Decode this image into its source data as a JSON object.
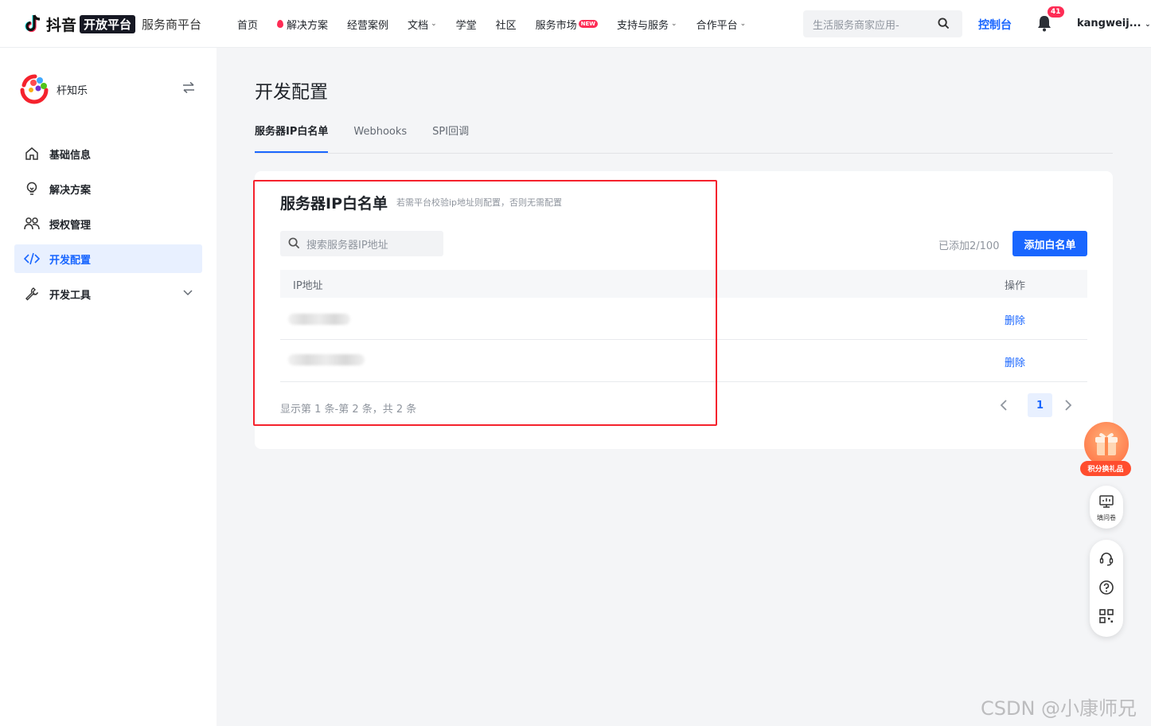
{
  "header": {
    "logo_word": "抖音",
    "logo_badge": "开放平台",
    "logo_sub": "服务商平台",
    "nav": [
      {
        "label": "首页"
      },
      {
        "label": "解决方案"
      },
      {
        "label": "经营案例"
      },
      {
        "label": "文档"
      },
      {
        "label": "学堂"
      },
      {
        "label": "社区"
      },
      {
        "label": "服务市场",
        "tag": "NEW"
      },
      {
        "label": "支持与服务"
      },
      {
        "label": "合作平台"
      }
    ],
    "search_placeholder": "生活服务商家应用-",
    "console": "控制台",
    "notifications": "41",
    "user": "kangweij..."
  },
  "sidebar": {
    "app_name": "杆知乐",
    "items": [
      {
        "label": "基础信息",
        "icon": "home-icon"
      },
      {
        "label": "解决方案",
        "icon": "bulb-icon"
      },
      {
        "label": "授权管理",
        "icon": "users-icon"
      },
      {
        "label": "开发配置",
        "icon": "code-icon",
        "active": true
      },
      {
        "label": "开发工具",
        "icon": "wrench-icon"
      }
    ]
  },
  "main": {
    "title": "开发配置",
    "tabs": [
      {
        "label": "服务器IP白名单",
        "active": true
      },
      {
        "label": "Webhooks"
      },
      {
        "label": "SPI回调"
      }
    ],
    "card": {
      "title": "服务器IP白名单",
      "hint": "若需平台校验ip地址则配置，否则无需配置",
      "search_placeholder": "搜索服务器IP地址",
      "added": "已添加2/100",
      "add_button": "添加白名单",
      "columns": [
        "IP地址",
        "操作"
      ],
      "rows": [
        {
          "action": "删除"
        },
        {
          "action": "删除"
        }
      ],
      "footer": "显示第 1 条-第 2 条，共 2 条",
      "current_page": "1"
    }
  },
  "floating": {
    "gift_label": "积分换礼品",
    "survey_label": "填问卷"
  },
  "watermark": "CSDN @小康师兄",
  "colors": {
    "accent": "#1966ff",
    "brand_red": "#fe2c55",
    "highlight": "#f5222d"
  }
}
